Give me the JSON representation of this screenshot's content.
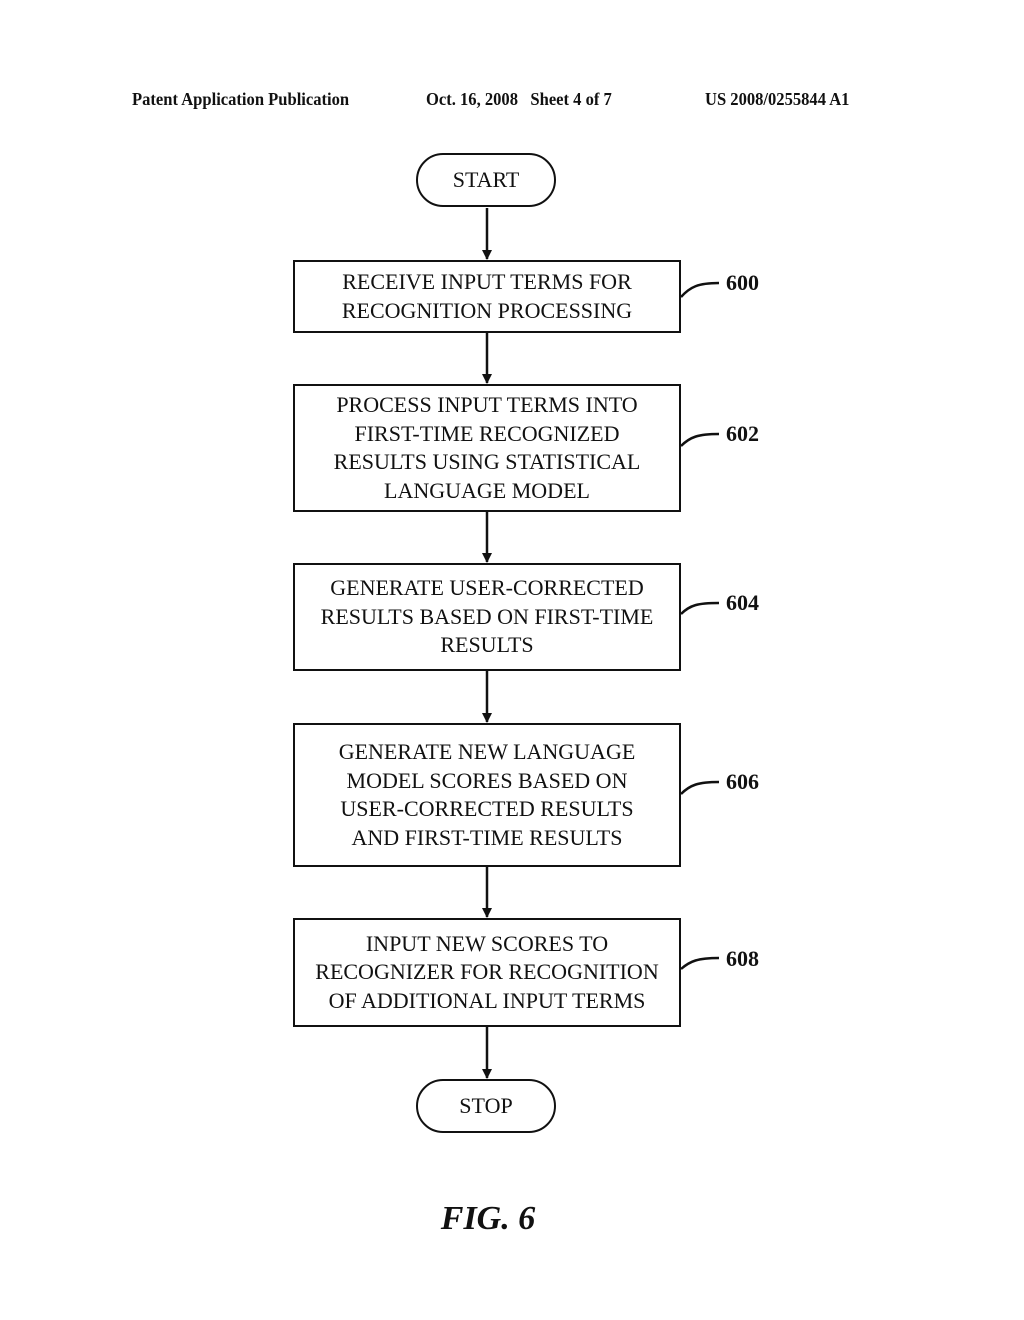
{
  "header": {
    "publication": "Patent Application Publication",
    "date_sheet": "Oct. 16, 2008   Sheet 4 of 7",
    "number": "US 2008/0255844 A1"
  },
  "flowchart": {
    "start_label": "START",
    "stop_label": "STOP",
    "steps": [
      {
        "ref": "600",
        "lines": [
          "RECEIVE INPUT TERMS FOR",
          "RECOGNITION PROCESSING"
        ]
      },
      {
        "ref": "602",
        "lines": [
          "PROCESS INPUT TERMS INTO",
          "FIRST-TIME RECOGNIZED",
          "RESULTS USING STATISTICAL",
          "LANGUAGE MODEL"
        ]
      },
      {
        "ref": "604",
        "lines": [
          "GENERATE USER-CORRECTED",
          "RESULTS BASED ON FIRST-TIME",
          "RESULTS"
        ]
      },
      {
        "ref": "606",
        "lines": [
          "GENERATE NEW LANGUAGE",
          "MODEL SCORES BASED ON",
          "USER-CORRECTED RESULTS",
          "AND FIRST-TIME RESULTS"
        ]
      },
      {
        "ref": "608",
        "lines": [
          "INPUT NEW SCORES TO",
          "RECOGNIZER FOR RECOGNITION",
          "OF ADDITIONAL INPUT TERMS"
        ]
      }
    ]
  },
  "figure_label": "FIG. 6"
}
